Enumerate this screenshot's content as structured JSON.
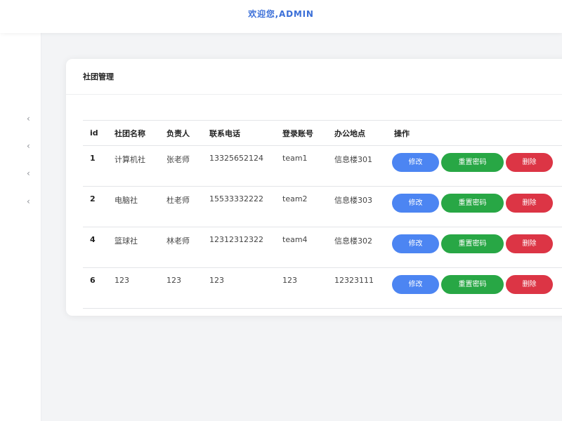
{
  "header": {
    "welcome": "欢迎您,ADMIN"
  },
  "sidebar": {
    "toggles": [
      {
        "icon": "chevron-left-icon",
        "glyph": "‹"
      },
      {
        "icon": "chevron-left-icon",
        "glyph": "‹"
      },
      {
        "icon": "chevron-left-icon",
        "glyph": "‹"
      },
      {
        "icon": "chevron-left-icon",
        "glyph": "‹"
      }
    ]
  },
  "card": {
    "title": "社团管理"
  },
  "table": {
    "columns": [
      "id",
      "社团名称",
      "负责人",
      "联系电话",
      "登录账号",
      "办公地点",
      "操作"
    ],
    "rows": [
      {
        "id": "1",
        "name": "计算机社",
        "leader": "张老师",
        "phone": "13325652124",
        "account": "team1",
        "location": "信息楼301"
      },
      {
        "id": "2",
        "name": "电脑社",
        "leader": "杜老师",
        "phone": "15533332222",
        "account": "team2",
        "location": "信息楼303"
      },
      {
        "id": "4",
        "name": "篮球社",
        "leader": "林老师",
        "phone": "12312312322",
        "account": "team4",
        "location": "信息楼302"
      },
      {
        "id": "6",
        "name": "123",
        "leader": "123",
        "phone": "123",
        "account": "123",
        "location": "12323111"
      }
    ],
    "actions": {
      "edit": "修改",
      "reset": "重置密码",
      "delete": "删除"
    }
  },
  "colors": {
    "accent": "#3b6fd8",
    "edit": "#4c85f2",
    "reset": "#28a745",
    "delete": "#dc3545"
  }
}
